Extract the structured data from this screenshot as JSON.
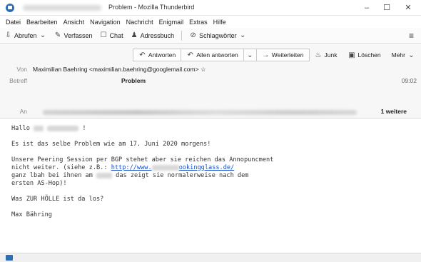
{
  "window": {
    "title": "Problem - Mozilla Thunderbird",
    "minimize": "–",
    "maximize": "☐",
    "close": "✕"
  },
  "menu": [
    "Datei",
    "Bearbeiten",
    "Ansicht",
    "Navigation",
    "Nachricht",
    "Enigmail",
    "Extras",
    "Hilfe"
  ],
  "toolbar": {
    "fetch": "Abrufen",
    "compose": "Verfassen",
    "chat": "Chat",
    "addressbook": "Adressbuch",
    "tags": "Schlagwörter",
    "menu": "≡"
  },
  "actions": {
    "reply": "Antworten",
    "reply_all": "Allen antworten",
    "forward": "Weiterleiten",
    "junk": "Junk",
    "delete": "Löschen",
    "more": "Mehr"
  },
  "header": {
    "from_label": "Von",
    "from_value": "Maximilian Baehring <maximilian.baehring@googlemail.com>",
    "subject_label": "Betreff",
    "subject_value": "Problem",
    "date": "09:02",
    "to_label": "An",
    "to_more": "1 weitere"
  },
  "body": {
    "greeting": "Hallo",
    "line1": "Es ist das selbe Problem wie am 17. Juni 2020 morgens!",
    "line2a": "Unsere Peering Session per BGP stehet aber sie reichen das Annopuncment",
    "line2b_pre": "nicht weiter. (siehe z.B.: ",
    "link_pre": "http://www.",
    "link_post": "ookingglass.de/",
    "line2c_pre": "ganz lbah bei ihnen am ",
    "line2c_post": " das zeigt sie normalerweise nach dem",
    "line2d": "ersten AS-Hop)!",
    "line3": "Was ZUR HÖLLE ist da los?",
    "signature": "Max Bähring"
  }
}
